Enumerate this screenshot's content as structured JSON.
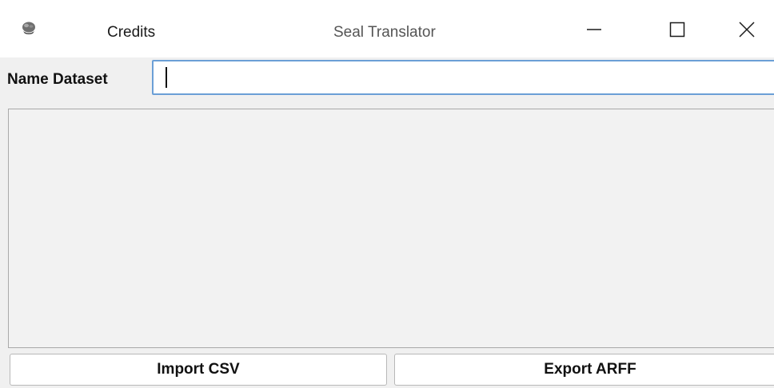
{
  "window": {
    "title": "Seal Translator",
    "menu": {
      "credits_label": "Credits"
    },
    "controls": {
      "minimize_icon": "minimize-icon",
      "maximize_icon": "maximize-icon",
      "close_icon": "close-icon"
    }
  },
  "form": {
    "name_label": "Name Dataset",
    "name_value": "",
    "name_placeholder": ""
  },
  "actions": {
    "import_label": "Import CSV",
    "export_label": "Export ARFF"
  },
  "colors": {
    "input_focus_border": "#6b9fd6",
    "panel_background": "#f2f2f2",
    "window_background": "#f0f0f0"
  }
}
